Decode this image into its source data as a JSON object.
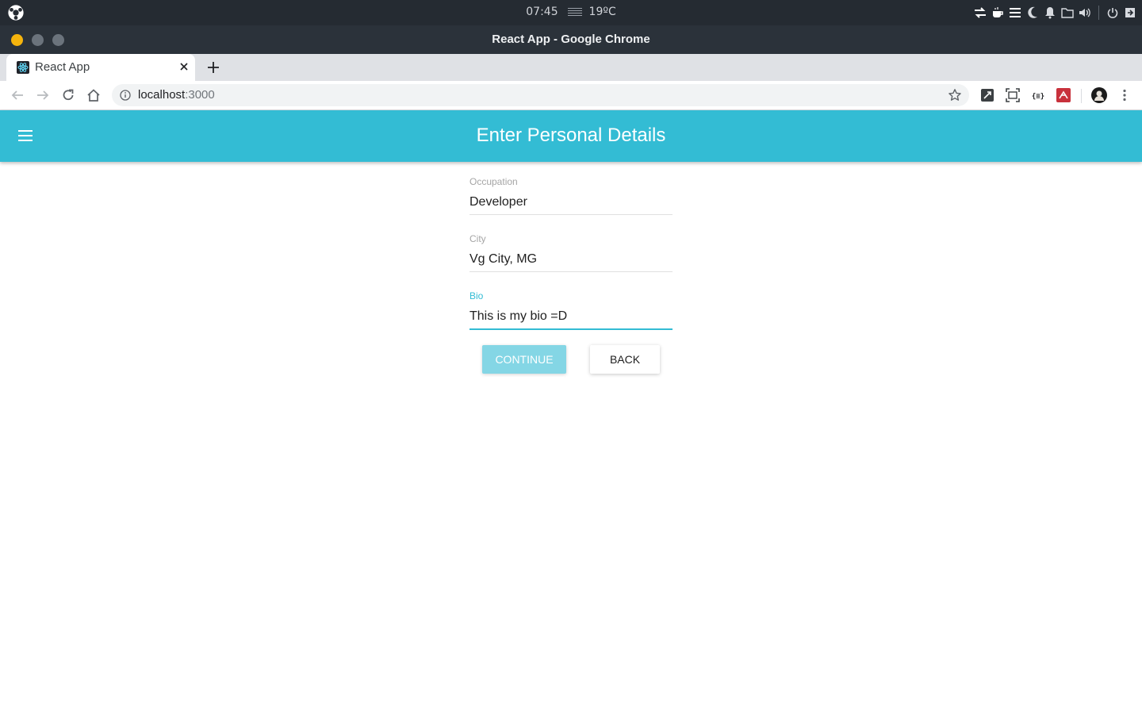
{
  "os": {
    "clock": "07:45",
    "weather": "19ºC"
  },
  "window": {
    "title": "React App - Google Chrome"
  },
  "browser": {
    "tab_title": "React App",
    "url_host": "localhost",
    "url_port": ":3000"
  },
  "app_bar": {
    "title": "Enter Personal Details"
  },
  "form": {
    "fields": [
      {
        "label": "Occupation",
        "value": "Developer"
      },
      {
        "label": "City",
        "value": "Vg City, MG"
      },
      {
        "label": "Bio",
        "value": "This is my bio =D"
      }
    ],
    "focused_field": "Bio",
    "continue_label": "CONTINUE",
    "back_label": "BACK"
  },
  "colors": {
    "app_bar": "#33bcd4",
    "continue_button": "#84d6e5",
    "focus_accent": "#33bcd4",
    "os_bar": "#252b32",
    "title_bar": "#2b323a"
  }
}
